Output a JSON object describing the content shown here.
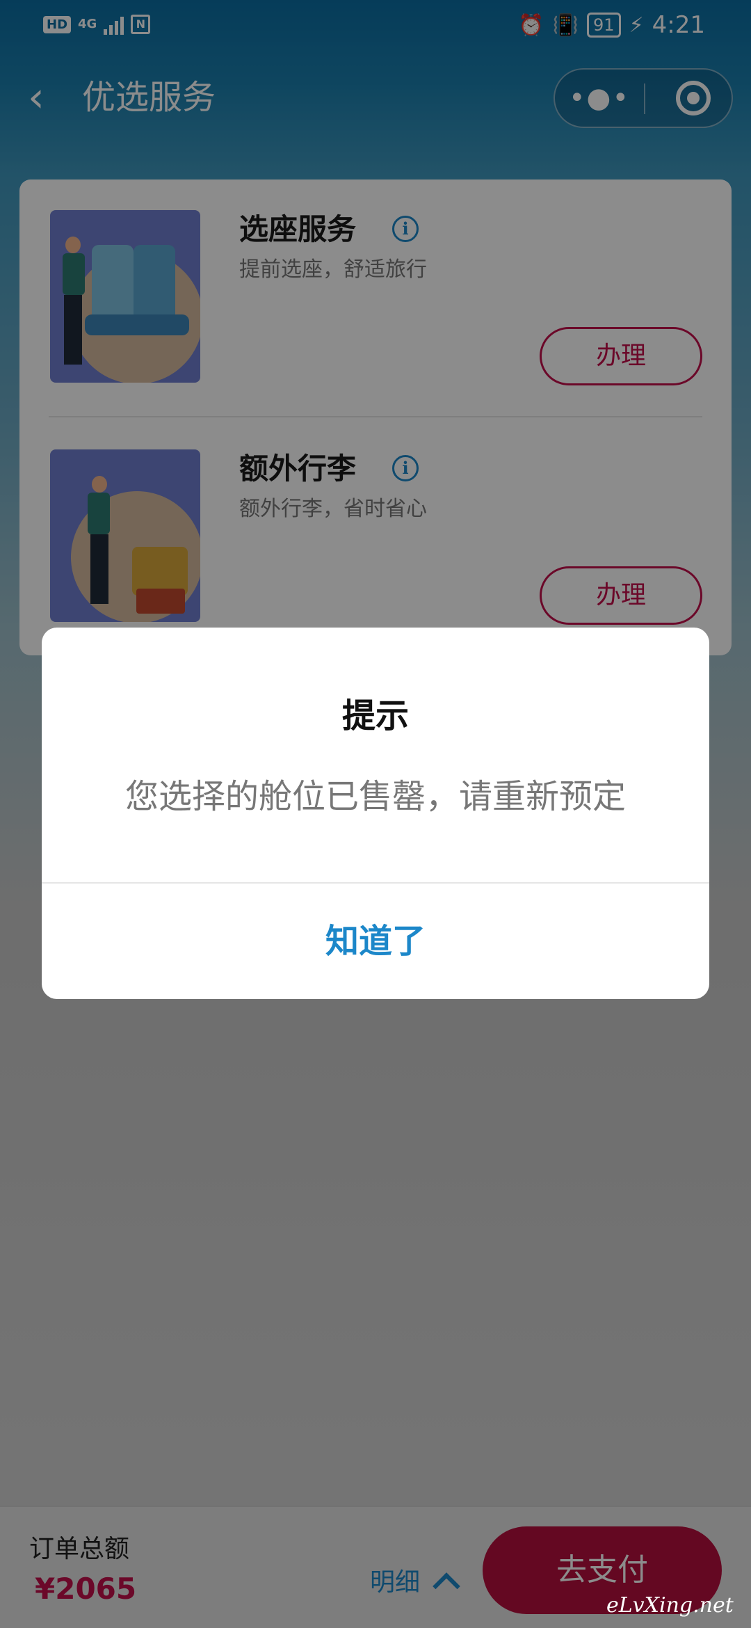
{
  "status_bar": {
    "hd_label": "HD",
    "network_label": "4G",
    "battery_level": "91",
    "time": "4:21",
    "icons": [
      "signal-icon",
      "nfc-icon",
      "alarm-icon",
      "vibrate-icon",
      "battery-icon",
      "charging-icon"
    ]
  },
  "header": {
    "title": "优选服务",
    "back_icon": "chevron-left-icon",
    "more_icon": "more-dots-icon",
    "close_icon": "target-close-icon"
  },
  "services": [
    {
      "name": "选座服务",
      "desc": "提前选座，舒适旅行",
      "button": "办理",
      "info_glyph": "i"
    },
    {
      "name": "额外行李",
      "desc": "额外行李，省时省心",
      "button": "办理",
      "info_glyph": "i"
    }
  ],
  "modal": {
    "title": "提示",
    "message": "您选择的舱位已售罄，请重新预定",
    "confirm": "知道了"
  },
  "bottom_bar": {
    "total_label": "订单总额",
    "total_amount": "¥2065",
    "detail_label": "明细",
    "pay_label": "去支付"
  },
  "watermark": "eLvXing.net",
  "colors": {
    "accent_blue": "#1c87c9",
    "accent_red": "#c4104c",
    "pay_button": "#b7103f",
    "header_blue": "#0b6ea3"
  }
}
